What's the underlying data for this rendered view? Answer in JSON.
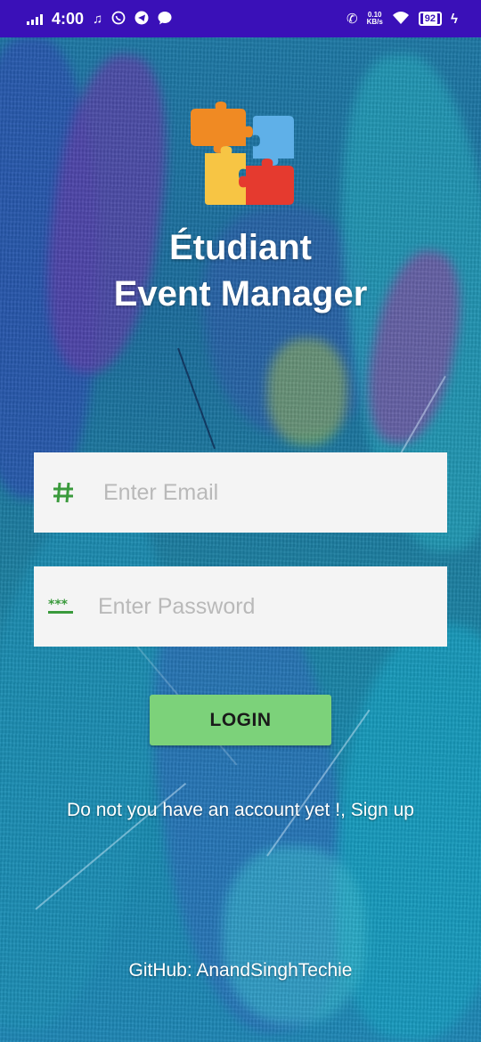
{
  "status_bar": {
    "time": "4:00",
    "net_speed_value": "0.10",
    "net_speed_unit": "KB/s",
    "battery": "92",
    "icons": [
      "signal-icon",
      "music-icon",
      "whatsapp-icon",
      "telegram-icon",
      "message-icon",
      "volte-call-icon",
      "wifi-icon",
      "battery-icon",
      "charging-icon"
    ]
  },
  "app": {
    "title_line1": "Étudiant",
    "title_line2": "Event Manager",
    "logo_icon": "puzzle-icon"
  },
  "form": {
    "email_placeholder": "Enter Email",
    "email_icon": "hash-icon",
    "password_placeholder": "Enter Password",
    "password_icon": "password-dots-icon",
    "login_label": "LOGIN"
  },
  "footer": {
    "signup_text": "Do not you have an account yet !, Sign up",
    "github_text": "GitHub: AnandSinghTechie"
  },
  "colors": {
    "status_bar": "#3a10b8",
    "accent_green": "#7cd27a",
    "icon_green": "#3a9a3c",
    "field_bg": "#f4f4f4"
  }
}
